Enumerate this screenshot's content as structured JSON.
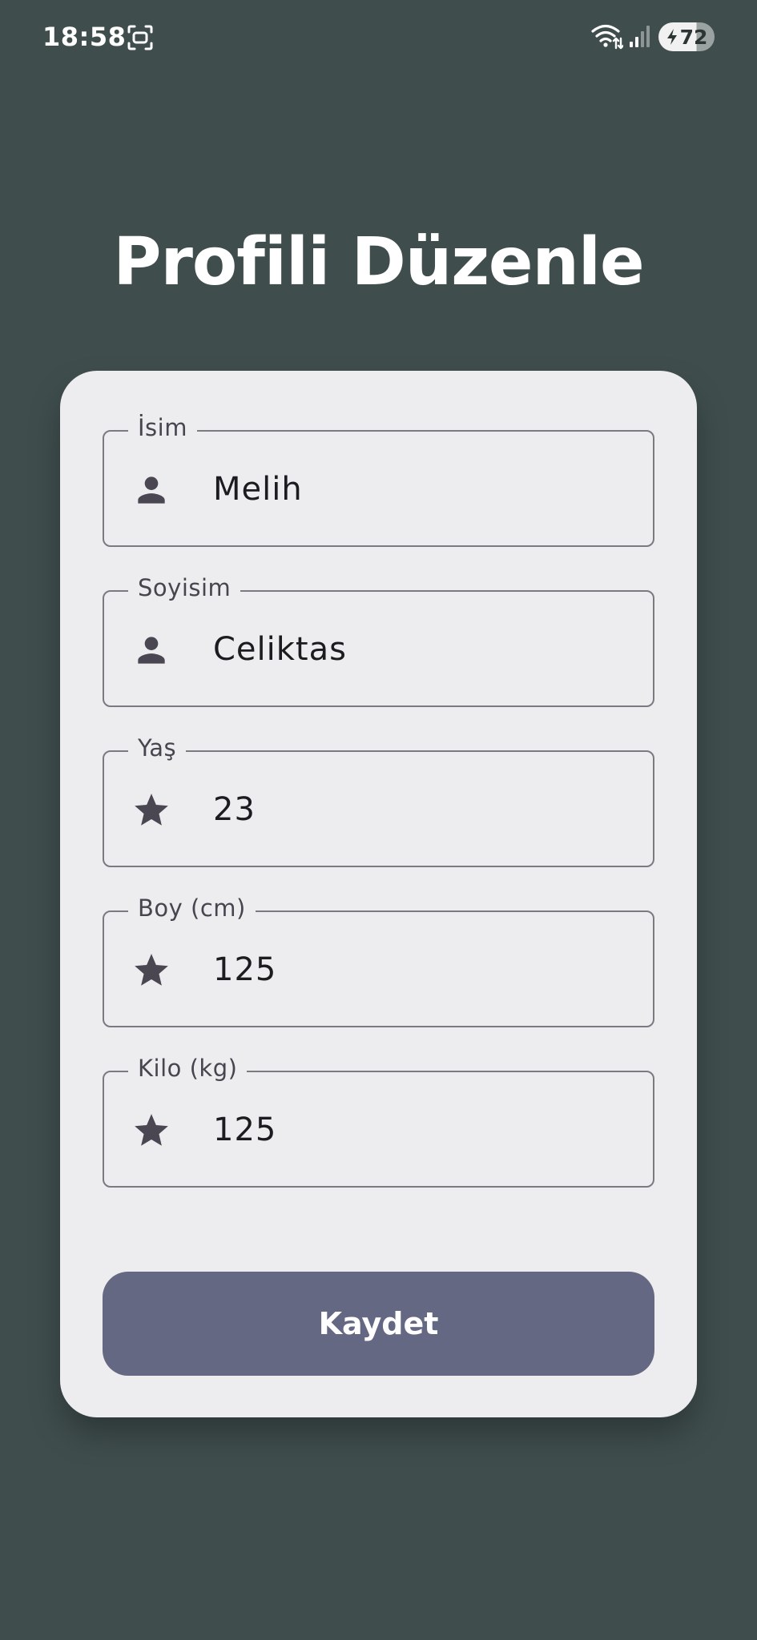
{
  "status_bar": {
    "time": "18:58",
    "battery_level": "72",
    "icons": [
      "screen-record-icon",
      "wifi-icon",
      "signal-icon",
      "battery-icon",
      "bolt-icon"
    ]
  },
  "page": {
    "title": "Profili Düzenle"
  },
  "form": {
    "fields": [
      {
        "label": "İsim",
        "value": "Melih",
        "icon": "person-icon"
      },
      {
        "label": "Soyisim",
        "value": "Celiktas",
        "icon": "person-icon"
      },
      {
        "label": "Yaş",
        "value": "23",
        "icon": "star-icon"
      },
      {
        "label": "Boy (cm)",
        "value": "125",
        "icon": "star-icon"
      },
      {
        "label": "Kilo (kg)",
        "value": "125",
        "icon": "star-icon"
      }
    ],
    "save_label": "Kaydet"
  },
  "colors": {
    "background": "#3f4e4d",
    "card": "#edecef",
    "field_border": "#7b7a80",
    "icon": "#4a4752",
    "button": "#656882",
    "title": "#ffffff"
  }
}
